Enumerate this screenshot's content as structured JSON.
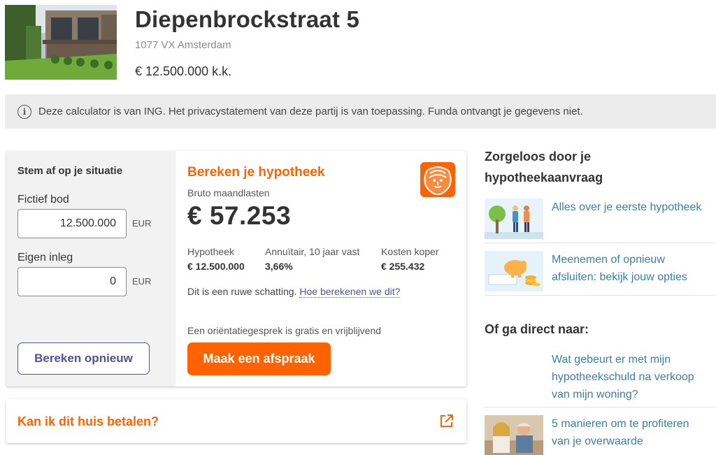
{
  "listing": {
    "title": "Diepenbrockstraat 5",
    "address": "1077 VX Amsterdam",
    "price": "€ 12.500.000 k.k."
  },
  "notice": {
    "text": "Deze calculator is van ING. Het privacystatement van deze partij is van toepassing. Funda ontvangt je gegevens niet.",
    "icon": "info-icon"
  },
  "calculator": {
    "left": {
      "title": "Stem af op je situatie",
      "bid_label": "Fictief bod",
      "bid_value": "12.500.000",
      "bid_unit": "EUR",
      "own_label": "Eigen inleg",
      "own_value": "0",
      "own_unit": "EUR",
      "recalc_label": "Bereken opnieuw"
    },
    "right": {
      "title": "Bereken je hypotheek",
      "bruto_label": "Bruto maandlasten",
      "bruto_value": "€ 57.253",
      "stats": [
        {
          "key": "Hypotheek",
          "value": "€ 12.500.000"
        },
        {
          "key": "Annuïtair, 10 jaar vast",
          "value": "3,66%"
        },
        {
          "key": "Kosten koper",
          "value": "€ 255.432"
        }
      ],
      "estimate_text": "Dit is een ruwe schatting.",
      "estimate_link": "Hoe berekenen we dit?",
      "orient_text": "Een oriëntatiegesprek is gratis en vrijblijvend",
      "cta_label": "Maak een afspraak"
    }
  },
  "afford": {
    "title": "Kan ik dit huis betalen?"
  },
  "sidebar": {
    "heading1": [
      "Zorgeloos door je",
      "hypotheekaanvraag"
    ],
    "items1": [
      {
        "lines": [
          "Alles over je eerste hypotheek"
        ]
      },
      {
        "lines": [
          "Meenemen of opnieuw",
          "afsluiten: bekijk jouw opties"
        ]
      }
    ],
    "heading2": "Of ga direct naar:",
    "items2": [
      {
        "lines": [
          "Wat gebeurt er met mijn",
          "hypotheekschuld na verkoop",
          "van mijn woning?"
        ]
      },
      {
        "lines": [
          "5 manieren om te profiteren",
          "van je overwaarde"
        ]
      }
    ]
  },
  "colors": {
    "ing_orange": "#ff6200",
    "ing_indigo": "#525199",
    "link_blue": "#3a7ea6"
  }
}
